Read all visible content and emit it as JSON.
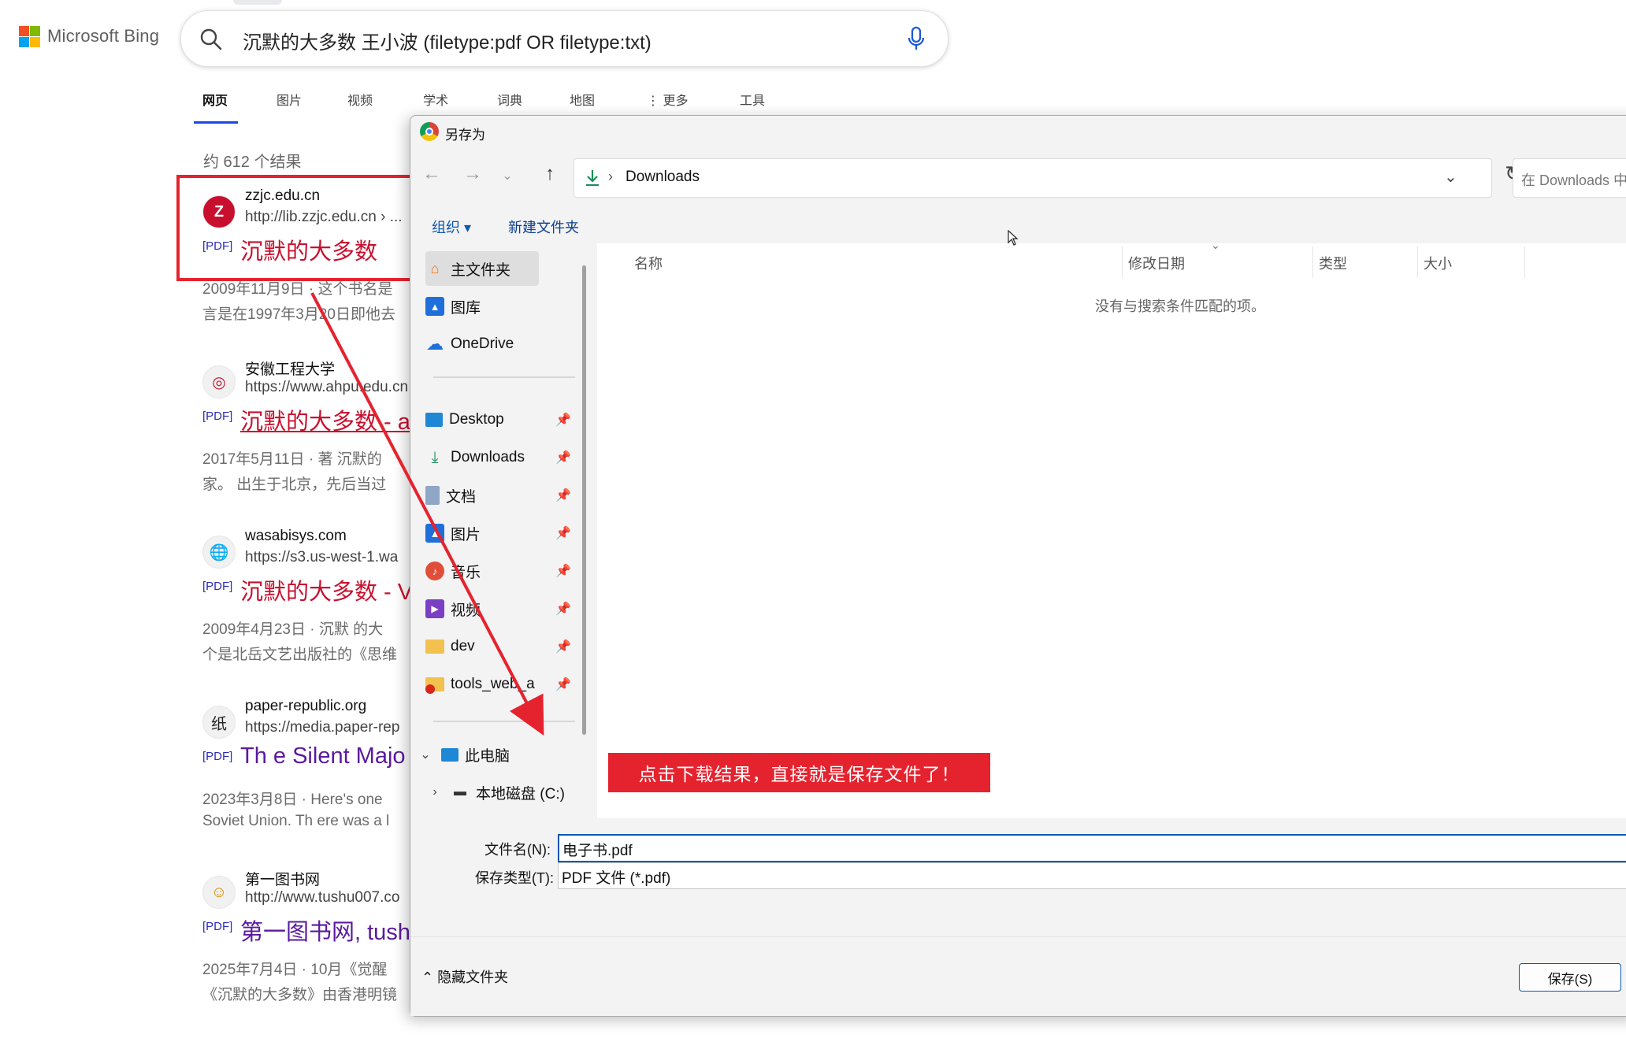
{
  "bing": {
    "logo_text": "Microsoft Bing",
    "query": "沉默的大多数 王小波 (filetype:pdf OR filetype:txt)",
    "tabs": [
      "网页",
      "图片",
      "视频",
      "学术",
      "词典",
      "地图",
      "更多",
      "工具"
    ],
    "result_count": "约 612 个结果",
    "results": [
      {
        "site": "zzjc.edu.cn",
        "url": "http://lib.zzjc.edu.cn › ...",
        "tag": "[PDF]",
        "title": "沉默的大多数",
        "snippet1": "2009年11月9日 · 这个书名是",
        "snippet2": "言是在1997年3月20日即他去",
        "favicon": "Z"
      },
      {
        "site": "安徽工程大学",
        "url": "https://www.ahpu.edu.cn",
        "tag": "[PDF]",
        "title": "沉默的大多数 - a",
        "snippet1": "2017年5月11日 · 著 沉默的",
        "snippet2": "家。 出生于北京，先后当过",
        "favicon": "◎"
      },
      {
        "site": "wasabisys.com",
        "url": "https://s3.us-west-1.wa",
        "tag": "[PDF]",
        "title": "沉默的大多数 - V",
        "snippet1": "2009年4月23日 · 沉默 的大",
        "snippet2": "个是北岳文艺出版社的《思维",
        "favicon": "🌐"
      },
      {
        "site": "paper-republic.org",
        "url": "https://media.paper-rep",
        "tag": "[PDF]",
        "title": "Th e Silent Majo",
        "snippet1": "2023年3月8日 · Here's one",
        "snippet2": "Soviet Union. Th ere was a l",
        "favicon": "纸"
      },
      {
        "site": "第一图书网",
        "url": "http://www.tushu007.co",
        "tag": "[PDF]",
        "title": "第一图书网, tush",
        "snippet1": "2025年7月4日 · 10月《觉醒",
        "snippet2": "《沉默的大多数》由香港明镜",
        "favicon": "☺"
      }
    ]
  },
  "dialog": {
    "title": "另存为",
    "path": "Downloads",
    "search_placeholder": "在 Downloads 中搜索",
    "toolbar": {
      "organize": "组织 ▾",
      "new_folder": "新建文件夹"
    },
    "sidebar": {
      "top": [
        {
          "label": "主文件夹",
          "icon": "home-icon"
        },
        {
          "label": "图库",
          "icon": "gallery-icon"
        },
        {
          "label": "OneDrive",
          "icon": "cloud-icon"
        }
      ],
      "pinned": [
        {
          "label": "Desktop",
          "icon": "desktop-icon"
        },
        {
          "label": "Downloads",
          "icon": "download-icon"
        },
        {
          "label": "文档",
          "icon": "document-icon"
        },
        {
          "label": "图片",
          "icon": "pictures-icon"
        },
        {
          "label": "音乐",
          "icon": "music-icon"
        },
        {
          "label": "视频",
          "icon": "video-icon"
        },
        {
          "label": "dev",
          "icon": "folder-icon"
        },
        {
          "label": "tools_web_a",
          "icon": "folder-icon"
        }
      ],
      "this_pc": "此电脑",
      "local_disk": "本地磁盘 (C:)"
    },
    "columns": [
      "名称",
      "修改日期",
      "类型",
      "大小"
    ],
    "empty_message": "没有与搜索条件匹配的项。",
    "filename_label": "文件名(N):",
    "filename_value": "电子书.pdf",
    "filetype_label": "保存类型(T):",
    "filetype_value": "PDF 文件 (*.pdf)",
    "hide_folders": "隐藏文件夹",
    "save_button": "保存(S)"
  },
  "annotation": "点击下载结果，直接就是保存文件了！",
  "colors": {
    "accent": "#e5232f",
    "link": "#0b57b3",
    "bing_blue": "#174ae4",
    "title_red": "#c8102e",
    "title_purple": "#5a1a9e"
  }
}
